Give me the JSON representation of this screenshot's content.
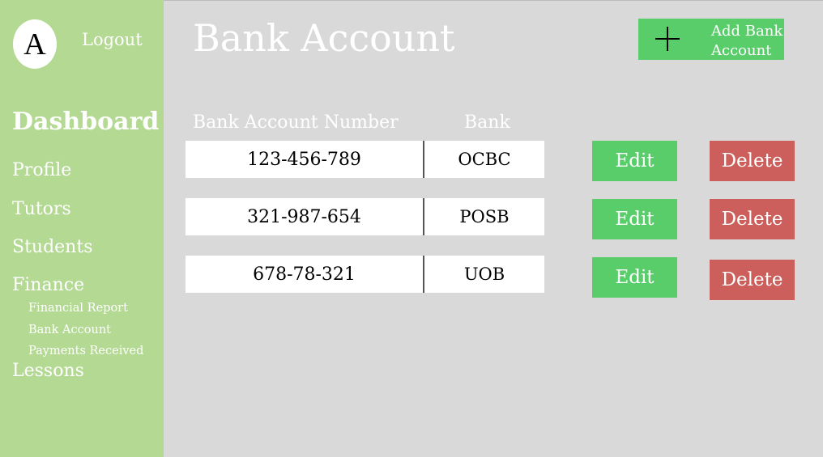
{
  "sidebar": {
    "avatar_initial": "A",
    "logout_label": "Logout",
    "dashboard_label": "Dashboard",
    "items": [
      "Profile",
      "Tutors",
      "Students",
      "Finance"
    ],
    "finance_sub": [
      "Financial Report",
      "Bank Account",
      "Payments Received"
    ],
    "lessons_label": "Lessons"
  },
  "main": {
    "title": "Bank Account",
    "add_button_label": "Add Bank Account",
    "columns": {
      "account_number": "Bank Account Number",
      "bank": "Bank"
    },
    "rows": [
      {
        "account_number": "123-456-789",
        "bank": "OCBC",
        "edit": "Edit",
        "delete": "Delete"
      },
      {
        "account_number": "321-987-654",
        "bank": "POSB",
        "edit": "Edit",
        "delete": "Delete"
      },
      {
        "account_number": "678-78-321",
        "bank": "UOB",
        "edit": "Edit",
        "delete": "Delete"
      }
    ]
  },
  "colors": {
    "sidebar_bg": "#b3d993",
    "main_bg": "#d9d9d9",
    "edit_green": "#5acd6b",
    "delete_red": "#cc5f5b"
  },
  "icons": {
    "add": "plus-icon"
  }
}
